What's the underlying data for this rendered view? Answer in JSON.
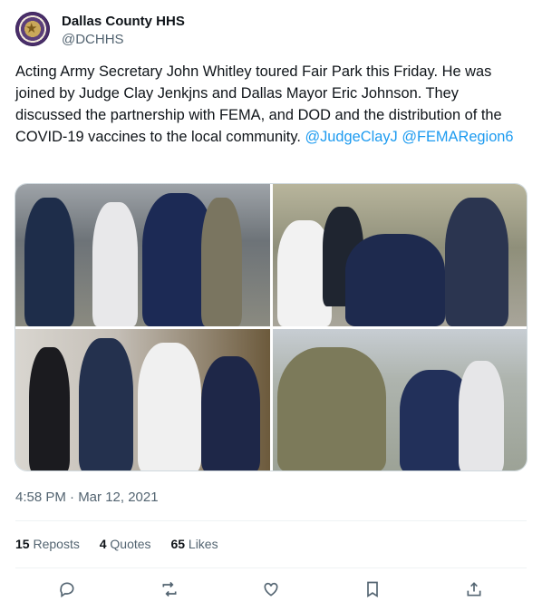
{
  "account": {
    "name": "Dallas County HHS",
    "handle": "@DCHHS"
  },
  "tweet": {
    "text": "Acting Army Secretary John Whitley toured Fair Park this Friday. He was joined by Judge Clay Jenkjns and Dallas Mayor Eric Johnson. They discussed the partnership with FEMA, and DOD and the distribution of the COVID-19 vaccines to the local community.",
    "mention_1": "@JudgeClayJ",
    "mention_2": "@FEMARegion6"
  },
  "timestamp": "4:58 PM · Mar 12, 2021",
  "stats": {
    "reposts_count": "15",
    "reposts_label": "Reposts",
    "quotes_count": "4",
    "quotes_label": "Quotes",
    "likes_count": "65",
    "likes_label": "Likes"
  },
  "actions": [
    "reply-icon",
    "repost-icon",
    "like-icon",
    "bookmark-icon",
    "share-icon"
  ],
  "colors": {
    "link": "#1d9bf0",
    "secondary_text": "#536471",
    "primary_text": "#0f1419"
  }
}
